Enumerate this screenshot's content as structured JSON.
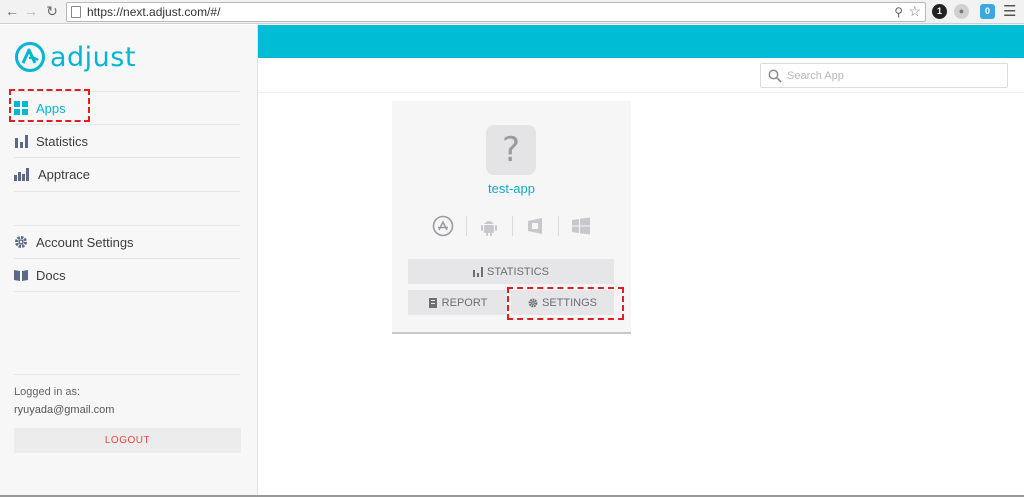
{
  "browser": {
    "url": "https://next.adjust.com/#/",
    "ext_badge_1": "1",
    "ext_badge_3": "0"
  },
  "sidebar": {
    "brand": "adjust",
    "items": [
      {
        "label": "Apps",
        "icon": "grid-icon",
        "active": true
      },
      {
        "label": "Statistics",
        "icon": "bar-chart-icon"
      },
      {
        "label": "Apptrace",
        "icon": "apptrace-icon"
      },
      {
        "label": "Account Settings",
        "icon": "gear-icon"
      },
      {
        "label": "Docs",
        "icon": "book-icon"
      }
    ],
    "logged_in_label": "Logged in as:",
    "email": "ryuyada@gmail.com",
    "logout_label": "LOGOUT"
  },
  "search": {
    "placeholder": "Search App"
  },
  "app_card": {
    "icon_glyph": "?",
    "name": "test-app",
    "platforms": [
      "app-store-icon",
      "android-icon",
      "windows-store-icon",
      "windows-icon"
    ],
    "statistics_label": "STATISTICS",
    "report_label": "REPORT",
    "settings_label": "SETTINGS"
  },
  "colors": {
    "brand": "#00b6d1",
    "topbar": "#00bcd4",
    "highlight": "#e02020",
    "logout": "#e04848"
  }
}
